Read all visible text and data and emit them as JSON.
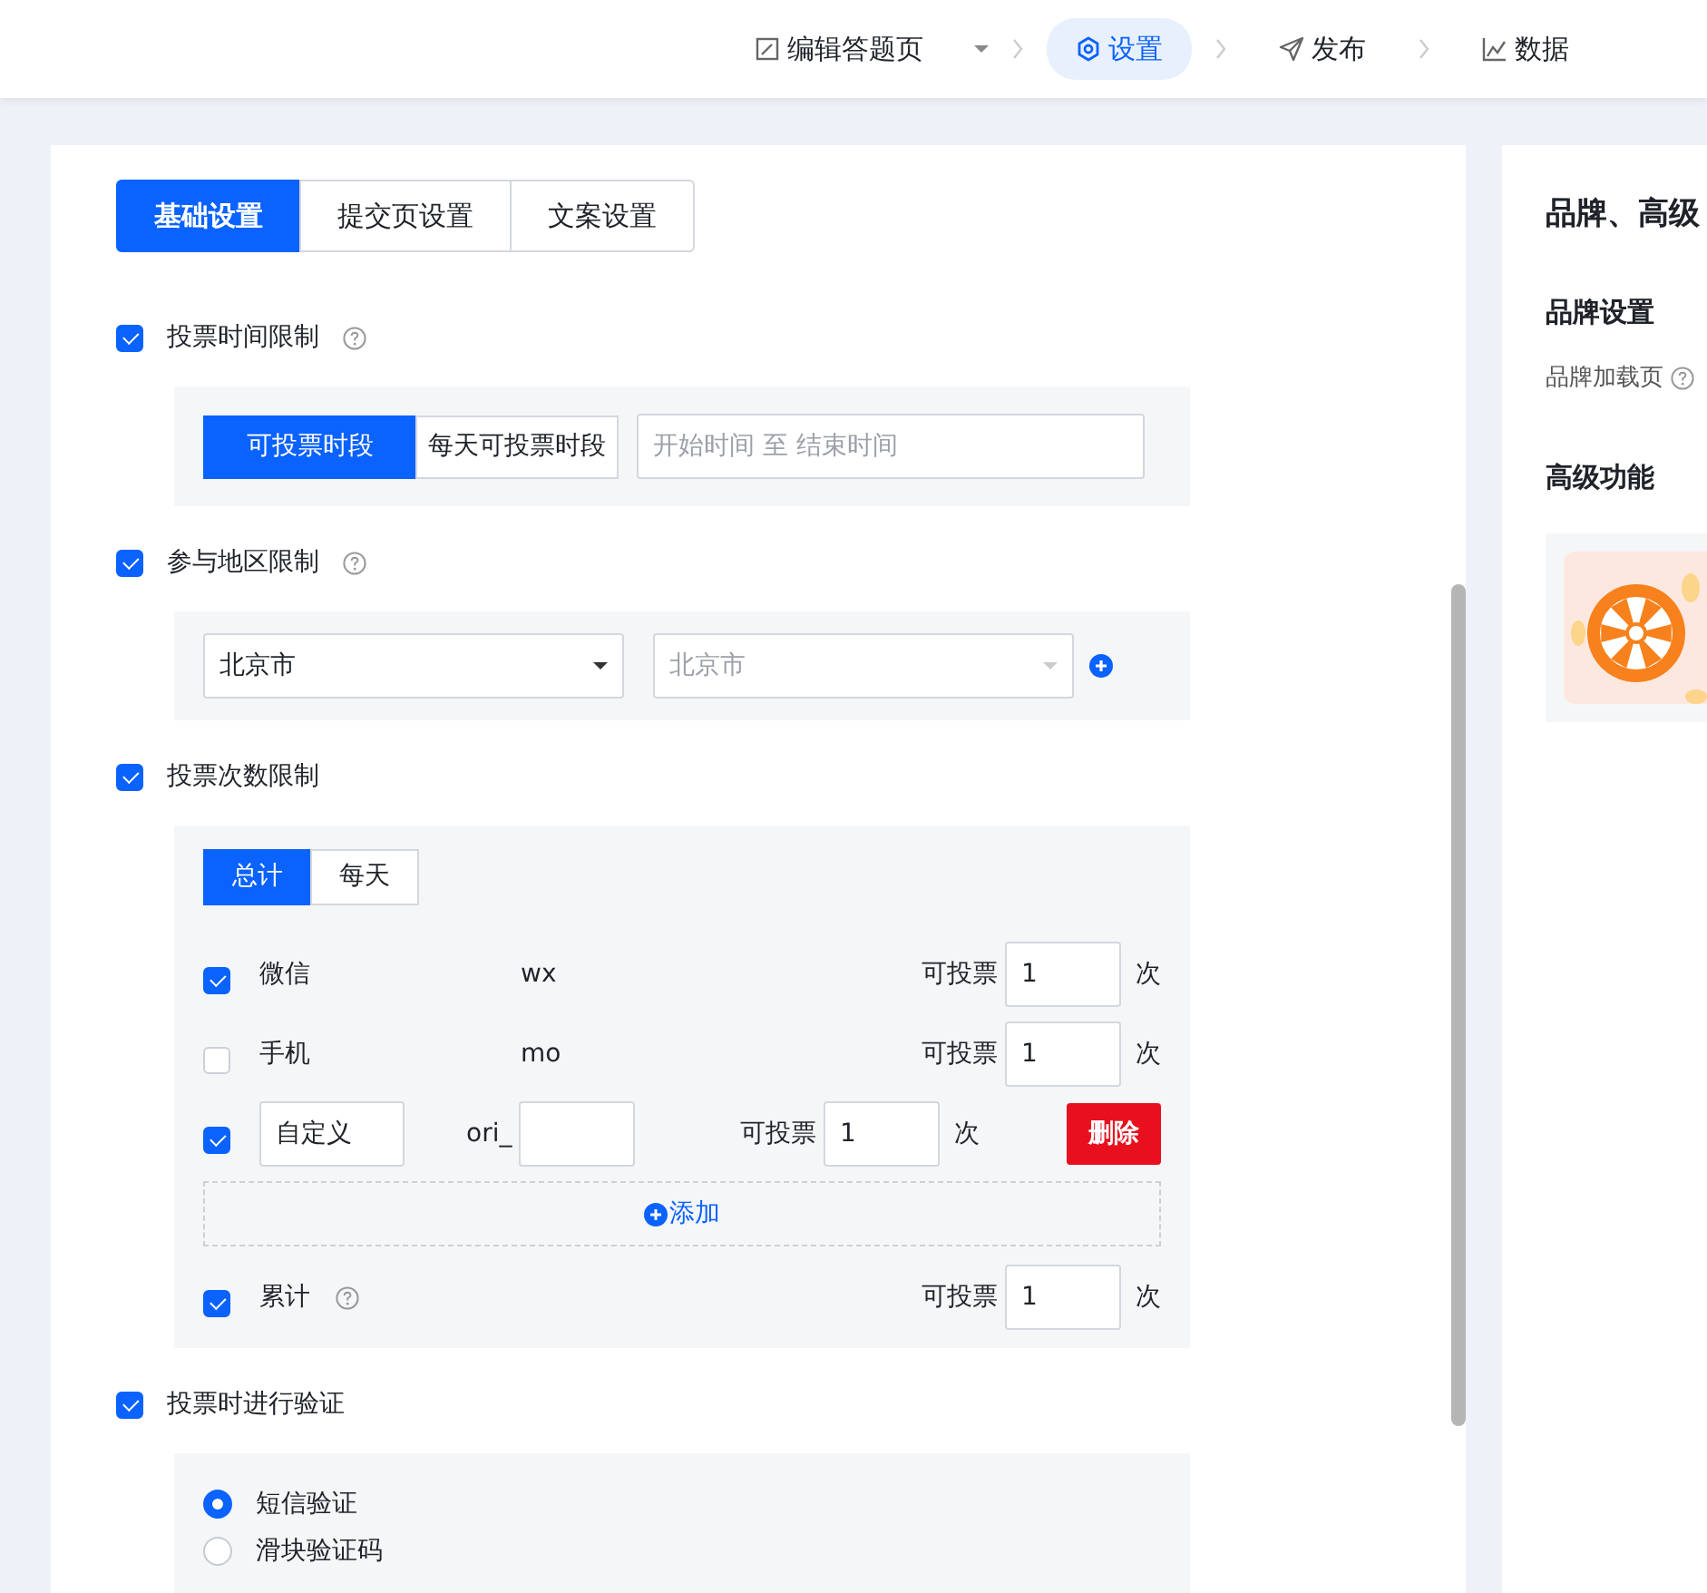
{
  "steps": [
    {
      "label": "编辑答题页",
      "selected": false,
      "dropdown": true
    },
    {
      "label": "设置",
      "selected": true,
      "dropdown": false
    },
    {
      "label": "发布",
      "selected": false,
      "dropdown": false
    },
    {
      "label": "数据",
      "selected": false,
      "dropdown": false
    }
  ],
  "tabs": [
    {
      "label": "基础设置",
      "selected": true
    },
    {
      "label": "提交页设置",
      "selected": false
    },
    {
      "label": "文案设置",
      "selected": false
    }
  ],
  "sections": [
    {
      "kind": "time",
      "label": "投票时间限制",
      "checked": true,
      "help": true,
      "modes": [
        {
          "label": "可投票时段",
          "selected": true
        },
        {
          "label": "每天可投票时段",
          "selected": false
        }
      ],
      "placeholder": "开始时间 至 结束时间"
    },
    {
      "kind": "region",
      "label": "参与地区限制",
      "checked": true,
      "help": true,
      "province": "北京市",
      "city": {
        "placeholder": "北京市",
        "disabled": true
      }
    },
    {
      "kind": "count",
      "label": "投票次数限制",
      "checked": true,
      "help": false,
      "modes": [
        {
          "label": "总计",
          "selected": true
        },
        {
          "label": "每天",
          "selected": false
        }
      ],
      "rows": [
        {
          "kind": "fixed",
          "checked": true,
          "name": "微信",
          "code": "wx",
          "prefix": "可投票",
          "value": "1",
          "unit": "次"
        },
        {
          "kind": "fixed",
          "checked": false,
          "name": "手机",
          "code": "mo",
          "prefix": "可投票",
          "value": "1",
          "unit": "次"
        },
        {
          "kind": "custom",
          "checked": true,
          "name": "自定义",
          "code_prefix": "ori_",
          "prefix": "可投票",
          "value": "1",
          "unit": "次",
          "delete": "删除"
        }
      ],
      "add": "添加",
      "total": {
        "checked": true,
        "name": "累计",
        "prefix": "可投票",
        "value": "1",
        "unit": "次"
      }
    },
    {
      "kind": "verify",
      "label": "投票时进行验证",
      "checked": true,
      "help": false,
      "options": [
        {
          "label": "短信验证",
          "selected": true
        },
        {
          "label": "滑块验证码",
          "selected": false
        }
      ]
    }
  ],
  "side": {
    "title": "品牌、高级",
    "brand_heading": "品牌设置",
    "brand_item": "品牌加载页",
    "advanced_heading": "高级功能"
  }
}
